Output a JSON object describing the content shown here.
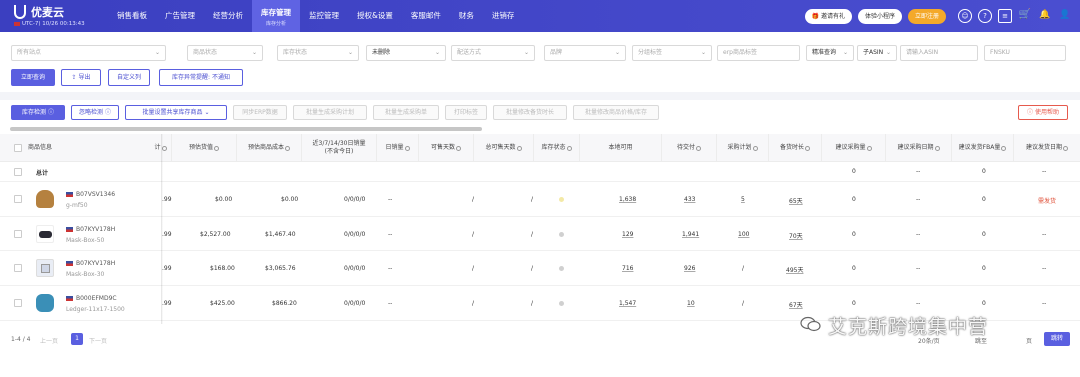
{
  "app": {
    "name": "优麦云",
    "timezone": "UTC-7) 10/26 00:13:43"
  },
  "nav": [
    {
      "label": "销售看板"
    },
    {
      "label": "广告管理"
    },
    {
      "label": "经营分析"
    },
    {
      "label": "库存管理",
      "sub": "库存分析",
      "active": true
    },
    {
      "label": "监控管理"
    },
    {
      "label": "授权&设置"
    },
    {
      "label": "客服邮件"
    },
    {
      "label": "财务"
    },
    {
      "label": "进销存"
    }
  ],
  "top_actions": {
    "invite": "邀请有礼",
    "mini_program": "体验小程序",
    "register": "立即注册"
  },
  "filters": {
    "store": "所有站点",
    "product_status": "商品状态",
    "stock_status": "库存状态",
    "deleted": "未删除",
    "ship_method": "配送方式",
    "brand": "品牌",
    "group_tag": "分组标签",
    "erp_tag": "erp商品标签",
    "match_mode": "精准查询",
    "asin_type": "子ASIN",
    "asin_placeholder": "请输入ASIN",
    "fnsku_placeholder": "FNSKU"
  },
  "filter_buttons": {
    "query": "立即查询",
    "export": "导出",
    "custom_columns": "自定义列",
    "alert": "库存异常提醒: 不通知"
  },
  "toolbar": {
    "stock_check": "库存检测",
    "ignore_check": "忽略检测",
    "batch_shared": "批量设置共享库存商品",
    "sync_erp": "同步ERP数据",
    "batch_purchase_plan": "批量生成采购计划",
    "batch_purchase_order": "批量生成采购单",
    "print_label": "打印标签",
    "batch_days": "批量修改备货时长",
    "batch_price": "批量修改商品价格/库存",
    "help": "使用帮助"
  },
  "table": {
    "headers": {
      "product": "商品信息",
      "hidden": "计",
      "est_value": "预估货值",
      "est_cost": "预估商品成本",
      "sales": "近3/7/14/30日销量\n(不含今日)",
      "daily": "日销量",
      "sellable_days": "可售天数",
      "total_sellable_days": "总可售天数",
      "stock_status": "库存状态",
      "local": "本地可用",
      "pending": "待交付",
      "purchase_plan": "采购计划",
      "lead_time": "备货时长",
      "suggest_qty": "建议采购量",
      "suggest_date": "建议采购日期",
      "suggest_fba": "建议发货FBA量",
      "suggest_ship_date": "建议发货日期"
    },
    "total_row": {
      "label": "总计",
      "suggest_qty": "0",
      "suggest_date": "--",
      "suggest_fba": "0",
      "suggest_ship_date": "--"
    },
    "rows": [
      {
        "asin": "B07VSV1346",
        "sku": "g-mf50",
        "hidden": ".99",
        "est_value": "$0.00",
        "est_cost": "$0.00",
        "sales": "0/0/0/0",
        "daily": "--",
        "sellable_days": "/",
        "total_sellable_days": "/",
        "status_color": "#f3e9a6",
        "local": "1,638",
        "pending": "433",
        "purchase_plan": "5",
        "lead_time": "65天",
        "suggest_qty": "0",
        "suggest_date": "--",
        "suggest_fba": "0",
        "suggest_ship_date": "需发货",
        "thumb_color": "#b5813f"
      },
      {
        "asin": "B07KYV178H",
        "sku": "Mask-Box-50",
        "hidden": ".99",
        "est_value": "$2,527.00",
        "est_cost": "$1,467.40",
        "sales": "0/0/0/0",
        "daily": "--",
        "sellable_days": "/",
        "total_sellable_days": "/",
        "status_color": "#d0d0d0",
        "local": "129",
        "pending": "1,941",
        "purchase_plan": "100",
        "lead_time": "70天",
        "suggest_qty": "0",
        "suggest_date": "--",
        "suggest_fba": "0",
        "suggest_ship_date": "--",
        "thumb_color": "#2b2b35"
      },
      {
        "asin": "B07KYV178H",
        "sku": "Mask-Box-30",
        "hidden": ".99",
        "est_value": "$168.00",
        "est_cost": "$3,065.76",
        "sales": "0/0/0/0",
        "daily": "--",
        "sellable_days": "/",
        "total_sellable_days": "/",
        "status_color": "#d0d0d0",
        "local": "716",
        "pending": "926",
        "purchase_plan": "/",
        "lead_time": "495天",
        "suggest_qty": "0",
        "suggest_date": "--",
        "suggest_fba": "0",
        "suggest_ship_date": "--",
        "thumb_color": "#cfd6e6"
      },
      {
        "asin": "B000EFMD9C",
        "sku": "Ledger-11x17-1500",
        "hidden": ".99",
        "est_value": "$425.00",
        "est_cost": "$866.20",
        "sales": "0/0/0/0",
        "daily": "--",
        "sellable_days": "/",
        "total_sellable_days": "/",
        "status_color": "#d0d0d0",
        "local": "1,547",
        "pending": "10",
        "purchase_plan": "/",
        "lead_time": "67天",
        "suggest_qty": "0",
        "suggest_date": "--",
        "suggest_fba": "0",
        "suggest_ship_date": "--",
        "thumb_color": "#3a8fb7"
      }
    ]
  },
  "pagination": {
    "range": "1-4 / 4",
    "prev": "上一页",
    "current": "1",
    "next": "下一页",
    "per_page": "20条/页",
    "goto": "跳至",
    "page_unit": "页",
    "jump": "跳转"
  },
  "watermark": "艾克斯跨境集中营"
}
